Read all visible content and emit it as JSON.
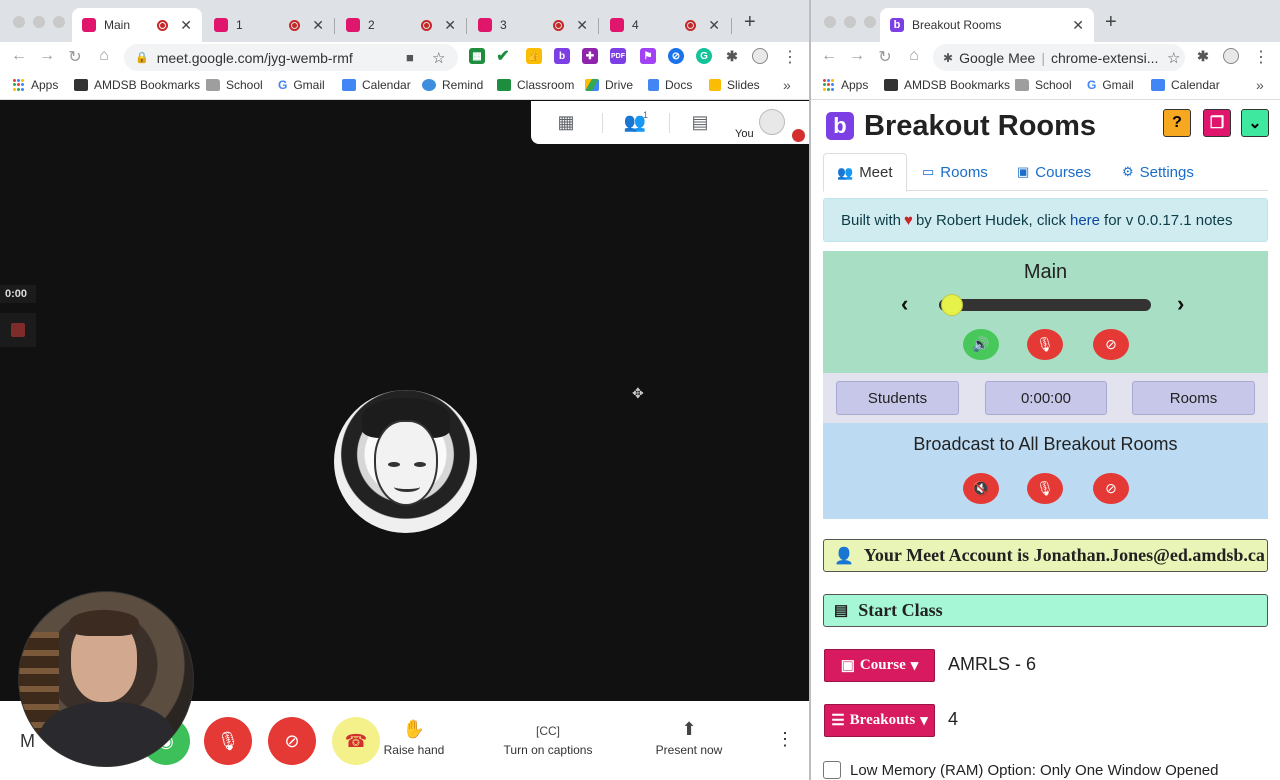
{
  "left": {
    "tabs": [
      {
        "label": "Main"
      },
      {
        "label": "1"
      },
      {
        "label": "2"
      },
      {
        "label": "3"
      },
      {
        "label": "4"
      }
    ],
    "url": "meet.google.com/jyg-wemb-rmf",
    "bookmarks": [
      "Apps",
      "AMDSB Bookmarks",
      "School",
      "Gmail",
      "Calendar",
      "Remind",
      "Classroom",
      "Drive",
      "Docs",
      "Slides"
    ],
    "more": "»",
    "meet": {
      "participant_count": "1",
      "you_label": "You",
      "timer": "0:00",
      "bottom_initial": "M",
      "raise_hand": "Raise hand",
      "captions": "Turn on captions",
      "present": "Present now"
    }
  },
  "right": {
    "tab_title": "Breakout Rooms",
    "omnibox_site": "Google Mee",
    "omnibox_ext": "chrome-extensi...",
    "bookmarks": [
      "Apps",
      "AMDSB Bookmarks",
      "School",
      "Gmail",
      "Calendar"
    ],
    "more": "»",
    "app": {
      "logo": "b",
      "title": "Breakout Rooms",
      "help": "?",
      "tabs": [
        "Meet",
        "Rooms",
        "Courses",
        "Settings"
      ],
      "info_prefix": "Built with",
      "info_middle": "by Robert Hudek, click",
      "info_link": "here",
      "info_suffix": "for v 0.0.17.1 notes",
      "room_name": "Main",
      "students_btn": "Students",
      "timer_btn": "0:00:00",
      "rooms_btn": "Rooms",
      "broadcast_title": "Broadcast to All Breakout Rooms",
      "account_text": "Your Meet Account is Jonathan.Jones@ed.amdsb.ca",
      "start_class": "Start Class",
      "course_btn": "Course",
      "course_value": "AMRLS - 6",
      "breakouts_btn": "Breakouts",
      "breakouts_value": "4",
      "low_memory": "Low Memory (RAM) Option: Only One Window Opened"
    }
  },
  "colors": {
    "brand_purple": "#7b3fe4",
    "pink": "#d81b60",
    "main_panel": "#a8dfc4",
    "broadcast_panel": "#bcdbf2"
  },
  "slider_value": 0
}
